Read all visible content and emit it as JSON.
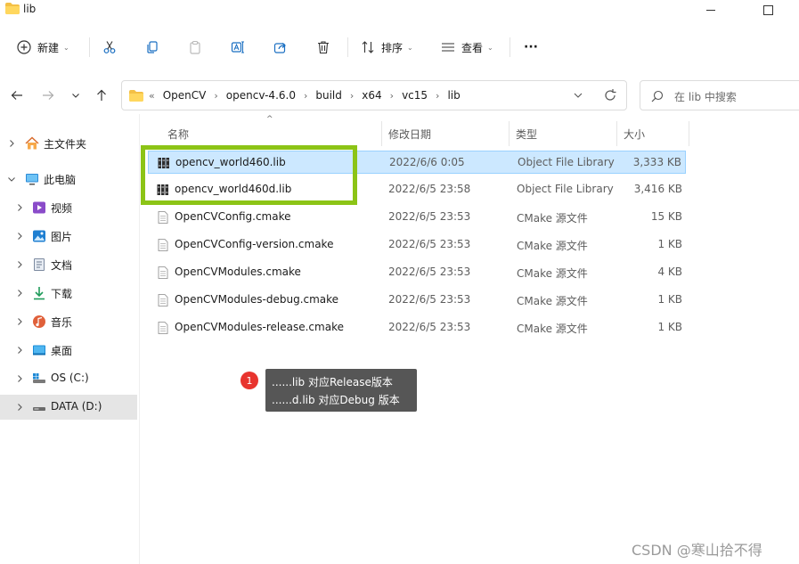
{
  "window": {
    "title": "lib"
  },
  "toolbar": {
    "new_label": "新建",
    "sort_label": "排序",
    "view_label": "查看",
    "more_label": "···"
  },
  "address": {
    "overflow": "«",
    "crumbs": [
      "OpenCV",
      "opencv-4.6.0",
      "build",
      "x64",
      "vc15",
      "lib"
    ],
    "separator": "›"
  },
  "search": {
    "placeholder": "在 lib 中搜索"
  },
  "sidebar": {
    "items": [
      {
        "label": "主文件夹",
        "icon": "home-icon",
        "chevron": "right"
      },
      {
        "label": "此电脑",
        "icon": "computer-icon",
        "chevron": "down"
      },
      {
        "label": "视频",
        "icon": "video-icon",
        "chevron": "right"
      },
      {
        "label": "图片",
        "icon": "picture-icon",
        "chevron": "right"
      },
      {
        "label": "文档",
        "icon": "document-icon",
        "chevron": "right"
      },
      {
        "label": "下载",
        "icon": "download-icon",
        "chevron": "right"
      },
      {
        "label": "音乐",
        "icon": "music-icon",
        "chevron": "right"
      },
      {
        "label": "桌面",
        "icon": "desktop-icon",
        "chevron": "right"
      },
      {
        "label": "OS (C:)",
        "icon": "drive-icon",
        "chevron": "right"
      },
      {
        "label": "DATA (D:)",
        "icon": "drive-icon",
        "chevron": "right",
        "selected": true
      }
    ]
  },
  "list": {
    "columns": {
      "name": "名称",
      "date": "修改日期",
      "type": "类型",
      "size": "大小"
    },
    "sort_indicator": "^",
    "files": [
      {
        "name": "opencv_world460.lib",
        "date": "2022/6/6 0:05",
        "type": "Object File Library",
        "size": "3,333 KB",
        "icon": "library-file-icon",
        "selected": true
      },
      {
        "name": "opencv_world460d.lib",
        "date": "2022/6/5 23:58",
        "type": "Object File Library",
        "size": "3,416 KB",
        "icon": "library-file-icon"
      },
      {
        "name": "OpenCVConfig.cmake",
        "date": "2022/6/5 23:53",
        "type": "CMake 源文件",
        "size": "15 KB",
        "icon": "text-file-icon"
      },
      {
        "name": "OpenCVConfig-version.cmake",
        "date": "2022/6/5 23:53",
        "type": "CMake 源文件",
        "size": "1 KB",
        "icon": "text-file-icon"
      },
      {
        "name": "OpenCVModules.cmake",
        "date": "2022/6/5 23:53",
        "type": "CMake 源文件",
        "size": "4 KB",
        "icon": "text-file-icon"
      },
      {
        "name": "OpenCVModules-debug.cmake",
        "date": "2022/6/5 23:53",
        "type": "CMake 源文件",
        "size": "1 KB",
        "icon": "text-file-icon"
      },
      {
        "name": "OpenCVModules-release.cmake",
        "date": "2022/6/5 23:53",
        "type": "CMake 源文件",
        "size": "1 KB",
        "icon": "text-file-icon"
      }
    ]
  },
  "annotation": {
    "badge": "1",
    "line1": "......lib   对应Release版本",
    "line2": "......d.lib 对应Debug 版本"
  },
  "watermark": "CSDN @寒山拾不得",
  "colors": {
    "highlight": "#8cc416",
    "selection": "#cce8ff",
    "badge": "#e8342e"
  }
}
